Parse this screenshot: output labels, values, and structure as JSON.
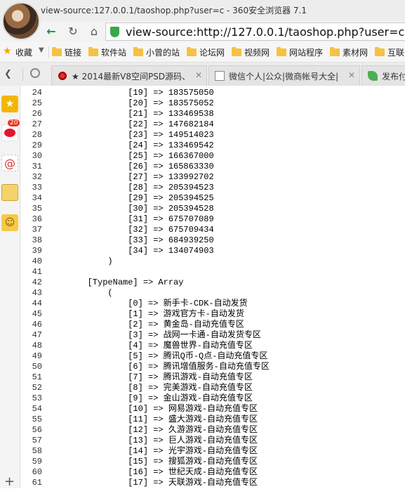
{
  "window": {
    "title": "view-source:127.0.0.1/taoshop.php?user=c - 360安全浏览器 7.1"
  },
  "nav": {
    "back_icon": "back-arrow-icon",
    "refresh_icon": "refresh-icon",
    "home_icon": "home-icon",
    "url": "view-source:http://127.0.0.1/taoshop.php?user=c"
  },
  "bookmarks": {
    "favorites_label": "收藏",
    "items": [
      "链接",
      "软件站",
      "小曾的站",
      "论坛网",
      "视频网",
      "网站程序",
      "素材网",
      "互联"
    ]
  },
  "tabs": [
    {
      "label": "★ 2014最新V8空间PSD源码、",
      "close": "✕"
    },
    {
      "label": "微信个人|公众|微商帐号大全|",
      "close": "✕"
    },
    {
      "label": "发布付"
    }
  ],
  "sidebar": {
    "badge": "20"
  },
  "source_lines": [
    {
      "n": "24",
      "t": "                [19] => 183575050"
    },
    {
      "n": "25",
      "t": "                [20] => 183575052"
    },
    {
      "n": "26",
      "t": "                [21] => 133469538"
    },
    {
      "n": "27",
      "t": "                [22] => 147682184"
    },
    {
      "n": "28",
      "t": "                [23] => 149514023"
    },
    {
      "n": "29",
      "t": "                [24] => 133469542"
    },
    {
      "n": "30",
      "t": "                [25] => 166367000"
    },
    {
      "n": "31",
      "t": "                [26] => 165863330"
    },
    {
      "n": "32",
      "t": "                [27] => 133992702"
    },
    {
      "n": "33",
      "t": "                [28] => 205394523"
    },
    {
      "n": "34",
      "t": "                [29] => 205394525"
    },
    {
      "n": "35",
      "t": "                [30] => 205394528"
    },
    {
      "n": "36",
      "t": "                [31] => 675707089"
    },
    {
      "n": "37",
      "t": "                [32] => 675709434"
    },
    {
      "n": "38",
      "t": "                [33] => 684939250"
    },
    {
      "n": "39",
      "t": "                [34] => 134074903"
    },
    {
      "n": "40",
      "t": "            )"
    },
    {
      "n": "41",
      "t": ""
    },
    {
      "n": "42",
      "t": "        [TypeName] => Array"
    },
    {
      "n": "43",
      "t": "            ("
    },
    {
      "n": "44",
      "t": "                [0] => 新手卡-CDK-自动发货"
    },
    {
      "n": "45",
      "t": "                [1] => 游戏官方卡-自动发货"
    },
    {
      "n": "46",
      "t": "                [2] => 黄金岛-自动充值专区"
    },
    {
      "n": "47",
      "t": "                [3] => 战网一卡通-自动发货专区"
    },
    {
      "n": "48",
      "t": "                [4] => 魔兽世界-自动充值专区"
    },
    {
      "n": "49",
      "t": "                [5] => 腾讯Q币-Q点-自动充值专区"
    },
    {
      "n": "50",
      "t": "                [6] => 腾讯增值服务-自动充值专区"
    },
    {
      "n": "51",
      "t": "                [7] => 腾讯游戏-自动充值专区"
    },
    {
      "n": "52",
      "t": "                [8] => 完美游戏-自动充值专区"
    },
    {
      "n": "53",
      "t": "                [9] => 金山游戏-自动充值专区"
    },
    {
      "n": "54",
      "t": "                [10] => 网易游戏-自动充值专区"
    },
    {
      "n": "55",
      "t": "                [11] => 盛大游戏-自动充值专区"
    },
    {
      "n": "56",
      "t": "                [12] => 久游游戏-自动充值专区"
    },
    {
      "n": "57",
      "t": "                [13] => 巨人游戏-自动充值专区"
    },
    {
      "n": "58",
      "t": "                [14] => 光宇游戏-自动充值专区"
    },
    {
      "n": "59",
      "t": "                [15] => 搜狐游戏-自动充值专区"
    },
    {
      "n": "60",
      "t": "                [16] => 世纪天成-自动充值专区"
    },
    {
      "n": "61",
      "t": "                [17] => 天联游戏-自动充值专区"
    }
  ]
}
